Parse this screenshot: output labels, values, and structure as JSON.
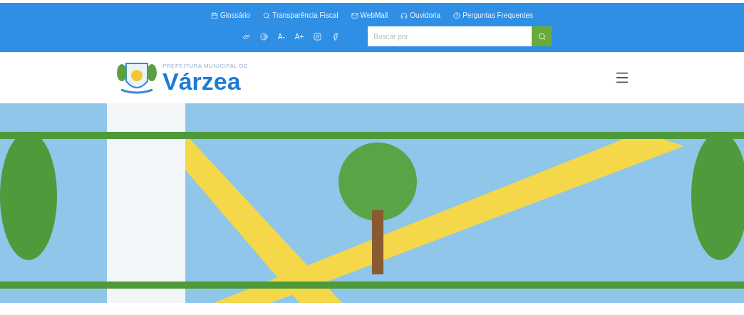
{
  "top_links": [
    {
      "kind": "calendar",
      "label": "Glossário"
    },
    {
      "kind": "search",
      "label": "Transparência Fiscal"
    },
    {
      "kind": "mail",
      "label": "WebMail"
    },
    {
      "kind": "headset",
      "label": "Ouvidoria"
    },
    {
      "kind": "help",
      "label": "Perguntas Frequentes"
    }
  ],
  "accessibility": [
    {
      "kind": "icon"
    },
    {
      "kind": "icon"
    },
    {
      "kind": "text",
      "label": "A-"
    },
    {
      "kind": "text",
      "label": "A+"
    },
    {
      "kind": "icon"
    },
    {
      "kind": "icon"
    }
  ],
  "search": {
    "placeholder": "Buscar por"
  },
  "logo": {
    "tagline": "PREFEITURA MUNICIPAL DE",
    "name": "Várzea"
  }
}
